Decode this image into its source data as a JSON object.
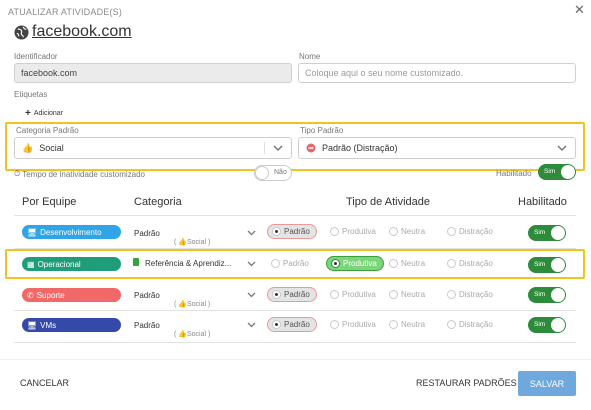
{
  "dialog": {
    "title": "ATUALIZAR ATIVIDADE(S)",
    "close_glyph": "✕"
  },
  "site": {
    "name": "facebook.com"
  },
  "identifier": {
    "label": "Identificador",
    "value": "facebook.com"
  },
  "name": {
    "label": "Nome",
    "placeholder": "Coloque aqui o seu nome customizado."
  },
  "tags": {
    "label": "Etiquetas",
    "add_label": "Adicionar"
  },
  "default_category": {
    "label": "Categoria Padrão",
    "value": "Social"
  },
  "default_type": {
    "label": "Tipo Padrão",
    "value": "Padrão (Distração)"
  },
  "inactivity": {
    "label": "Tempo de inatividade customizado",
    "toggle_text": "Não"
  },
  "enabled_global": {
    "label": "Habilitado",
    "toggle_text": "Sim"
  },
  "table": {
    "headers": {
      "team": "Por Equipe",
      "category": "Categoria",
      "type": "Tipo de Atividade",
      "enabled": "Habilitado"
    },
    "rows": [
      {
        "team": "Desenvolvimento",
        "team_color": "#2fa4e7",
        "team_icon": "monitor-icon",
        "category": "Padrão",
        "category_sub": "Social",
        "options": [
          "Padrão",
          "Produtiva",
          "Neutra",
          "Distração"
        ],
        "selected": "Padrão",
        "enabled": "Sim"
      },
      {
        "team": "Operacional",
        "team_color": "#1f9d7a",
        "team_icon": "building-icon",
        "category": "Referência & Aprendiz...",
        "category_sub": "",
        "options": [
          "Padrão",
          "Produtiva",
          "Neutra",
          "Distração"
        ],
        "selected": "Produtiva",
        "enabled": "Sim"
      },
      {
        "team": "Suporte",
        "team_color": "#f06868",
        "team_icon": "phone-icon",
        "category": "Padrão",
        "category_sub": "Social",
        "options": [
          "Padrão",
          "Produtiva",
          "Neutra",
          "Distração"
        ],
        "selected": "Padrão",
        "enabled": "Sim"
      },
      {
        "team": "VMs",
        "team_color": "#3549a8",
        "team_icon": "monitor-icon",
        "category": "Padrão",
        "category_sub": "Social",
        "options": [
          "Padrão",
          "Produtiva",
          "Neutra",
          "Distração"
        ],
        "selected": "Padrão",
        "enabled": "Sim"
      }
    ]
  },
  "footer": {
    "cancel": "CANCELAR",
    "restore": "RESTAURAR PADRÕES",
    "save": "SALVAR"
  },
  "colors": {
    "accent_yellow": "#f2c21d",
    "toggle_green": "#2e8b3c",
    "save_blue": "#6fa8dc"
  }
}
